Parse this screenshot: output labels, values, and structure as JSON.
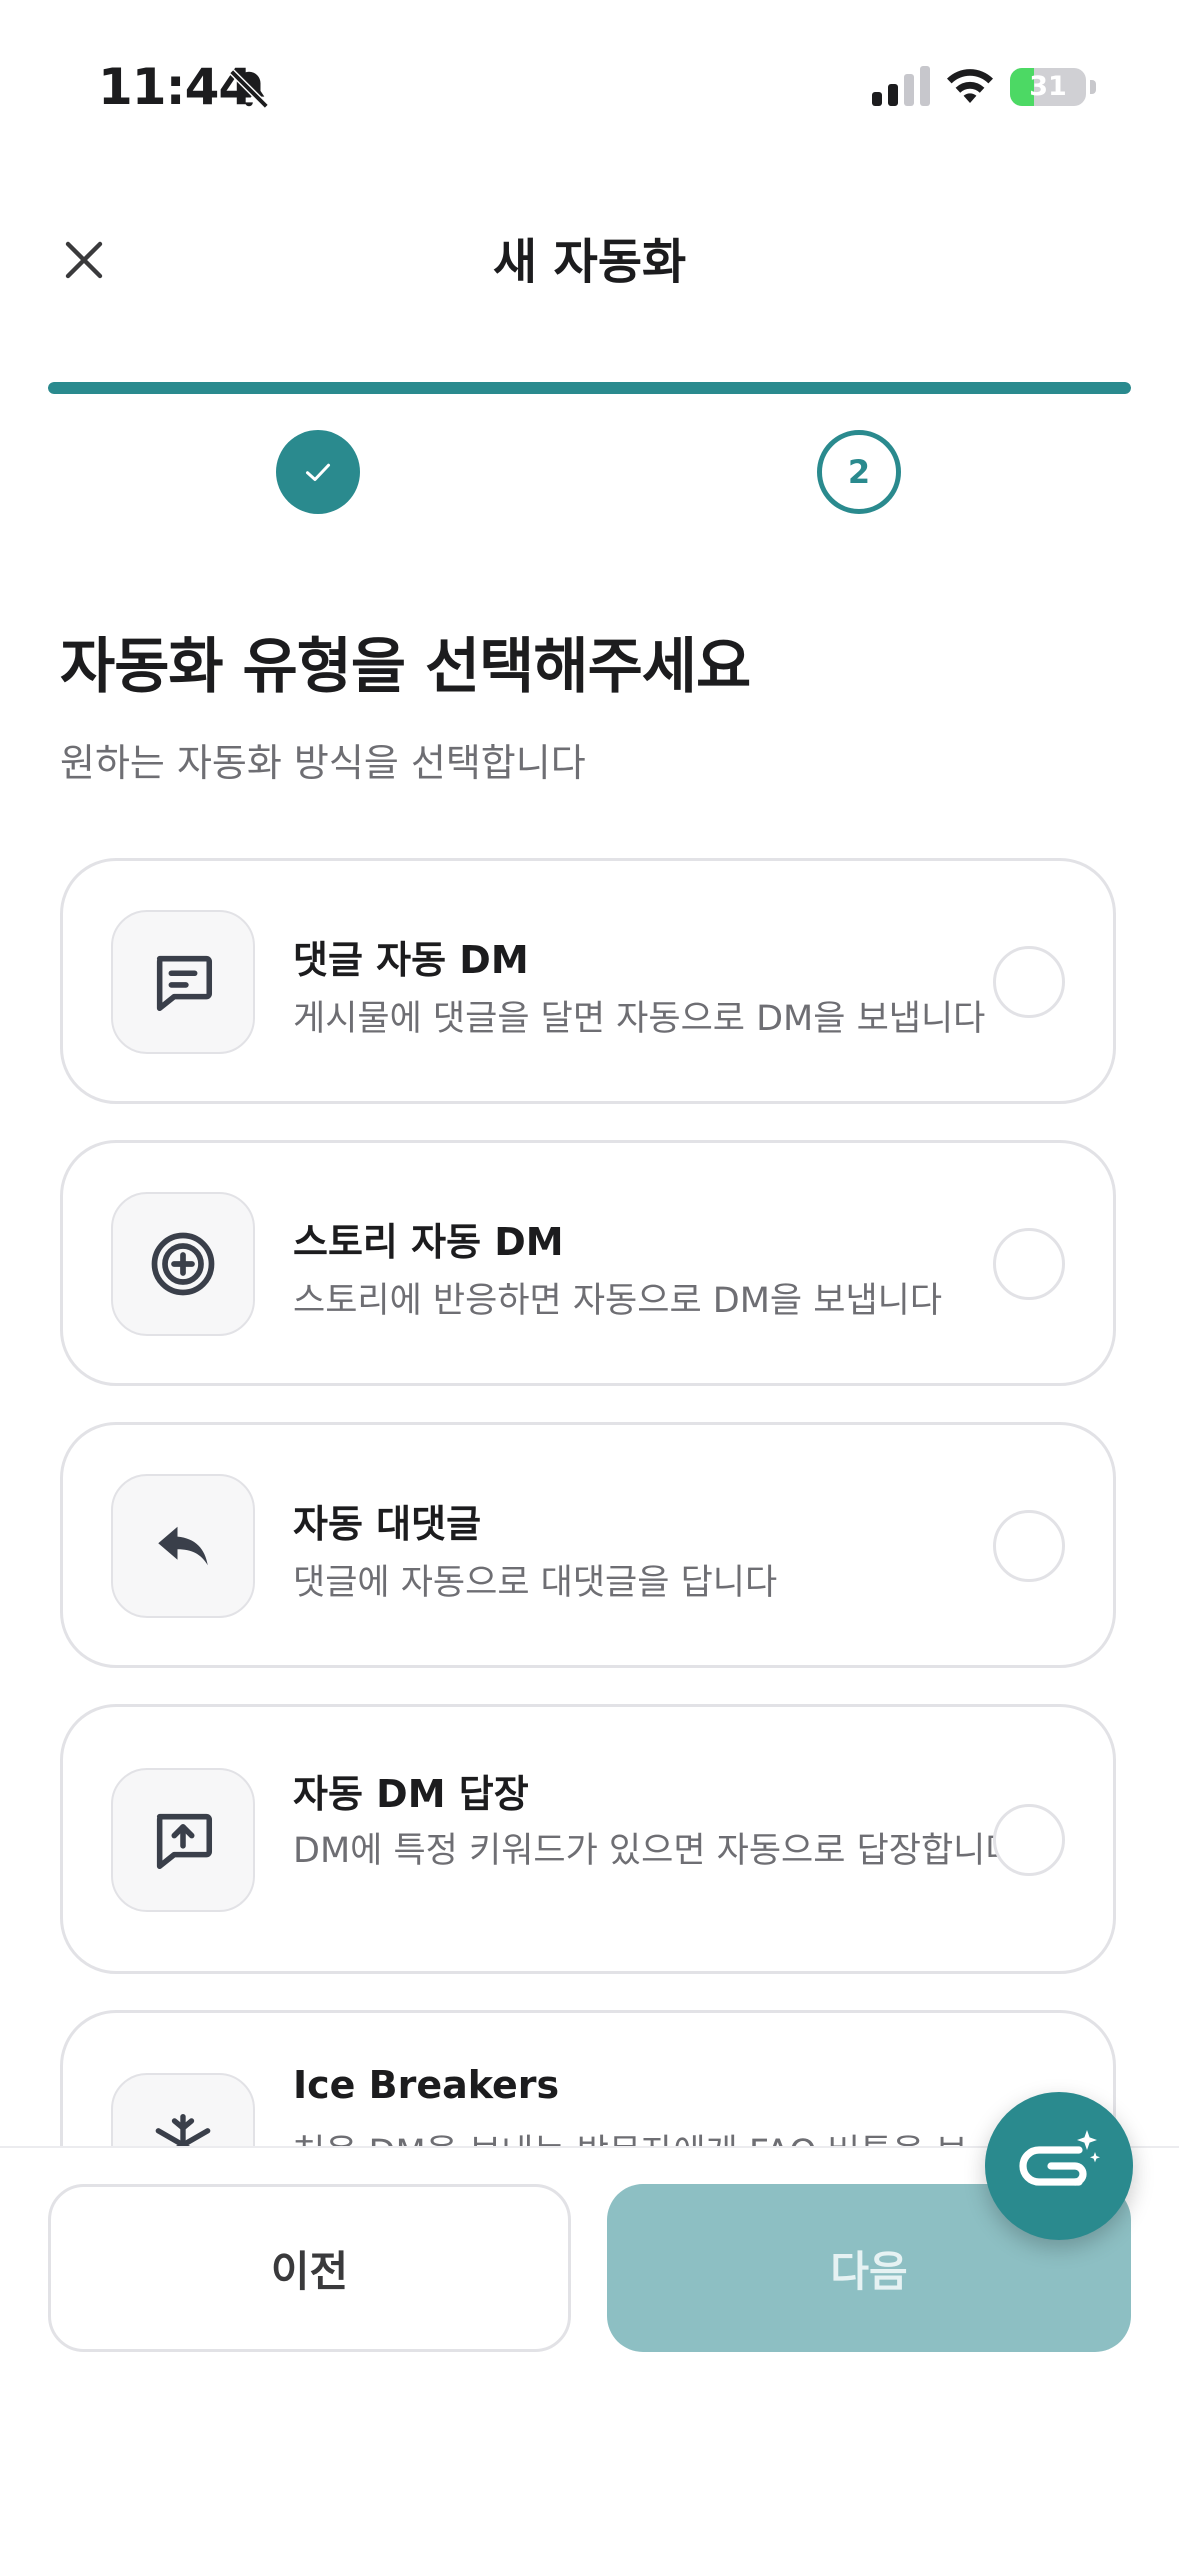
{
  "status_bar": {
    "time": "11:44",
    "battery_level": 31,
    "battery_label": "31"
  },
  "header": {
    "title": "새 자동화",
    "close_icon": "close-icon"
  },
  "progress": {
    "fraction": 1.0,
    "steps": [
      {
        "state": "done",
        "icon": "check-icon"
      },
      {
        "state": "current",
        "label": "2"
      }
    ]
  },
  "section": {
    "title": "자동화 유형을 선택해주세요",
    "subtitle": "원하는 자동화 방식을 선택합니다"
  },
  "options": [
    {
      "icon": "comment-icon",
      "title": "댓글 자동 DM",
      "description": "게시물에 댓글을 달면 자동으로 DM을 보냅니다",
      "selected": false
    },
    {
      "icon": "story-icon",
      "title": "스토리 자동 DM",
      "description": "스토리에 반응하면 자동으로 DM을 보냅니다",
      "selected": false
    },
    {
      "icon": "reply-icon",
      "title": "자동 대댓글",
      "description": "댓글에 자동으로 대댓글을 답니다",
      "selected": false
    },
    {
      "icon": "dm-reply-icon",
      "title": "자동 DM 답장",
      "description": "DM에 특정 키워드가 있으면 자동으로 답장합니다",
      "selected": false
    },
    {
      "icon": "snowflake-icon",
      "title": "Ice Breakers",
      "description": "처음 DM을 보내는 방문자에게 FAQ 버튼을 보",
      "selected": false
    }
  ],
  "footer": {
    "prev_label": "이전",
    "next_label": "다음"
  },
  "fab": {
    "icon": "ai-assistant-icon"
  },
  "colors": {
    "accent": "#2a8a8e",
    "accent_disabled": "#8dbfc3",
    "border": "#e2e2e6",
    "muted_text": "#6e6e73"
  }
}
